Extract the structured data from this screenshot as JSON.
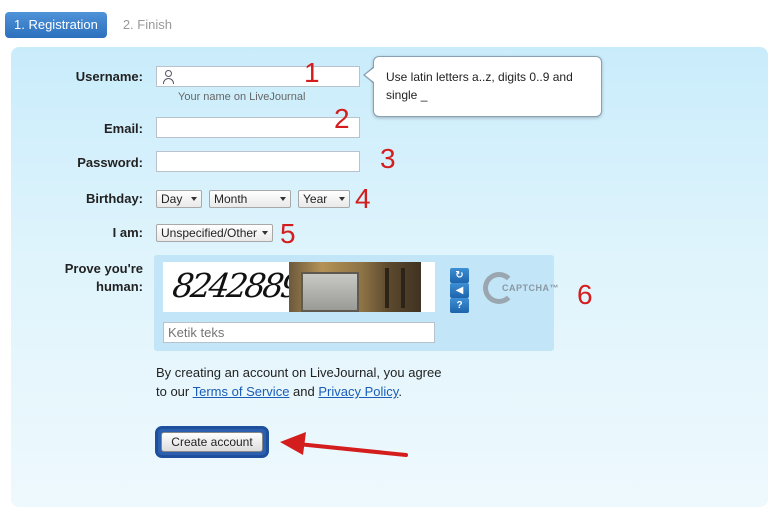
{
  "steps": {
    "active": "1. Registration",
    "next": "2. Finish"
  },
  "form": {
    "username_label": "Username:",
    "username_hint": "Your name on LiveJournal",
    "email_label": "Email:",
    "password_label": "Password:",
    "birthday_label": "Birthday:",
    "birthday_day": "Day",
    "birthday_month": "Month",
    "birthday_year": "Year",
    "gender_label": "I am:",
    "gender_value": "Unspecified/Other",
    "human_label_1": "Prove you're",
    "human_label_2": "human:",
    "captcha_text": "8242889",
    "captcha_placeholder": "Ketik teks",
    "captcha_brand": "CAPTCHA™",
    "agree_text_1": "By creating an account on LiveJournal, you agree",
    "agree_text_2_prefix": "to our ",
    "terms_link": "Terms of Service",
    "and_text": " and ",
    "privacy_link": "Privacy Policy",
    "period": ".",
    "create_button": "Create account"
  },
  "tooltip": {
    "line1": "Use latin letters a..z, digits 0..9 and",
    "line2": "single _"
  },
  "annotations": {
    "n1": "1",
    "n2": "2",
    "n3": "3",
    "n4": "4",
    "n5": "5",
    "n6": "6"
  },
  "colors": {
    "accent": "#2c6fbd",
    "annotation": "#d41e1e",
    "link": "#1a5cb8"
  },
  "icons": {
    "username": "user-icon",
    "reload": "reload-icon",
    "audio": "audio-icon",
    "help": "help-icon"
  }
}
